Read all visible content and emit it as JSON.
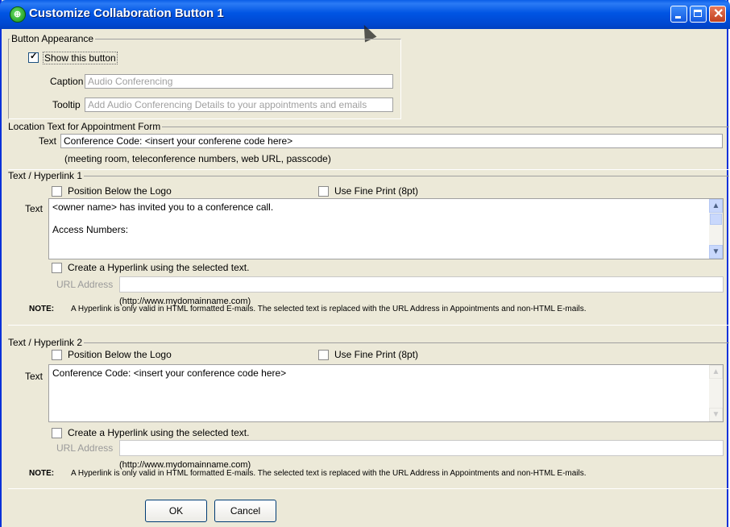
{
  "window": {
    "title": "Customize Collaboration Button 1"
  },
  "button_appearance": {
    "group_title": "Button Appearance",
    "show_button_label": "Show this button",
    "show_button_checked": true,
    "caption_label": "Caption",
    "caption_placeholder": "Audio Conferencing",
    "tooltip_label": "Tooltip",
    "tooltip_placeholder": "Add Audio Conferencing Details to your appointments and emails"
  },
  "location_text": {
    "group_title": "Location Text for Appointment Form",
    "text_label": "Text",
    "text_value": "Conference Code: <insert your conferene code here>",
    "hint": "(meeting room, teleconference numbers, web URL, passcode)"
  },
  "hyperlink1": {
    "group_title": "Text / Hyperlink 1",
    "position_below_logo": "Position Below the Logo",
    "use_fine_print": "Use Fine Print (8pt)",
    "text_label": "Text",
    "text_lines": [
      "<owner name> has invited you to a conference call.",
      "",
      "Access Numbers:"
    ],
    "create_hyperlink": "Create a Hyperlink using the selected text.",
    "url_label": "URL Address",
    "url_hint": "(http://www.mydomainname.com)",
    "note_label": "NOTE:",
    "note_text": "A Hyperlink is only valid in HTML formatted E-mails. The selected text is replaced with the URL Address in Appointments and non-HTML E-mails."
  },
  "hyperlink2": {
    "group_title": "Text / Hyperlink 2",
    "position_below_logo": "Position Below the Logo",
    "use_fine_print": "Use Fine Print (8pt)",
    "text_label": "Text",
    "text_lines": [
      "Conference Code: <insert your conference code here>"
    ],
    "create_hyperlink": "Create a Hyperlink using the selected text.",
    "url_label": "URL Address",
    "url_hint": "(http://www.mydomainname.com)",
    "note_label": "NOTE:",
    "note_text": "A Hyperlink is only valid in HTML formatted E-mails. The selected text is replaced with the URL Address in Appointments and non-HTML E-mails."
  },
  "buttons": {
    "ok": "OK",
    "cancel": "Cancel"
  },
  "colors": {
    "titlebar": "#0054e3",
    "dialog_bg": "#ece9d8",
    "close_button": "#c1401f"
  }
}
